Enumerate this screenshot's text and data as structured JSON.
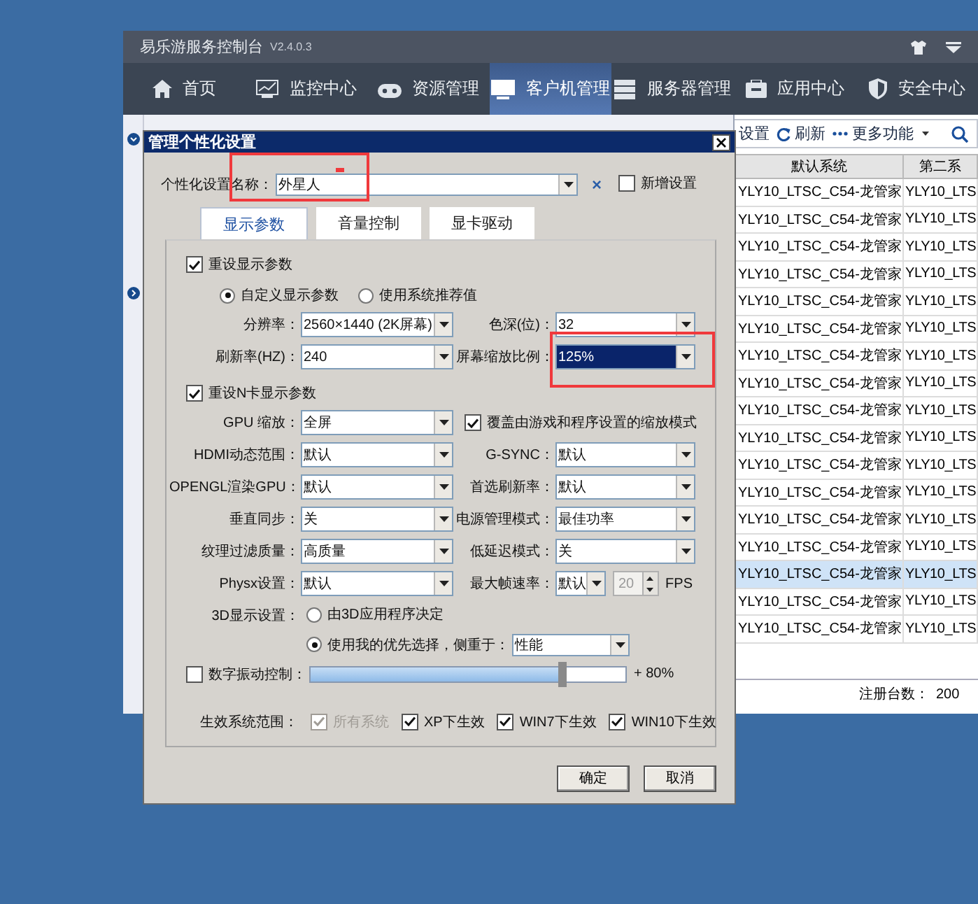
{
  "app": {
    "title": "易乐游服务控制台",
    "version": "V2.4.0.3"
  },
  "nav": [
    {
      "label": "首页",
      "selected": false
    },
    {
      "label": "监控中心",
      "selected": false
    },
    {
      "label": "资源管理",
      "selected": false
    },
    {
      "label": "客户机管理",
      "selected": true
    },
    {
      "label": "服务器管理",
      "selected": false
    },
    {
      "label": "应用中心",
      "selected": false
    },
    {
      "label": "安全中心",
      "selected": false
    }
  ],
  "toolbar": [
    {
      "label": "设置"
    },
    {
      "label": "刷新"
    },
    {
      "label": "更多功能"
    }
  ],
  "table": {
    "columns": [
      "默认系统",
      "第二系"
    ],
    "rows": [
      {
        "cells": [
          "YLY10_LTSC_C54-龙管家",
          "YLY10_LTS"
        ],
        "selected": false
      },
      {
        "cells": [
          "YLY10_LTSC_C54-龙管家",
          "YLY10_LTS"
        ],
        "selected": false
      },
      {
        "cells": [
          "YLY10_LTSC_C54-龙管家",
          "YLY10_LTS"
        ],
        "selected": false
      },
      {
        "cells": [
          "YLY10_LTSC_C54-龙管家",
          "YLY10_LTS"
        ],
        "selected": false
      },
      {
        "cells": [
          "YLY10_LTSC_C54-龙管家",
          "YLY10_LTS"
        ],
        "selected": false
      },
      {
        "cells": [
          "YLY10_LTSC_C54-龙管家",
          "YLY10_LTS"
        ],
        "selected": false
      },
      {
        "cells": [
          "YLY10_LTSC_C54-龙管家",
          "YLY10_LTS"
        ],
        "selected": false
      },
      {
        "cells": [
          "YLY10_LTSC_C54-龙管家",
          "YLY10_LTS"
        ],
        "selected": false
      },
      {
        "cells": [
          "YLY10_LTSC_C54-龙管家",
          "YLY10_LTS"
        ],
        "selected": false
      },
      {
        "cells": [
          "YLY10_LTSC_C54-龙管家",
          "YLY10_LTS"
        ],
        "selected": false
      },
      {
        "cells": [
          "YLY10_LTSC_C54-龙管家",
          "YLY10_LTS"
        ],
        "selected": false
      },
      {
        "cells": [
          "YLY10_LTSC_C54-龙管家",
          "YLY10_LTS"
        ],
        "selected": false
      },
      {
        "cells": [
          "YLY10_LTSC_C54-龙管家",
          "YLY10_LTS"
        ],
        "selected": false
      },
      {
        "cells": [
          "YLY10_LTSC_C54-龙管家",
          "YLY10_LTS"
        ],
        "selected": false
      },
      {
        "cells": [
          "YLY10_LTSC_C54-龙管家",
          "YLY10_LTS"
        ],
        "selected": true
      },
      {
        "cells": [
          "YLY10_LTSC_C54-龙管家",
          "YLY10_LTS"
        ],
        "selected": false
      },
      {
        "cells": [
          "YLY10_LTSC_C54-龙管家",
          "YLY10_LTS"
        ],
        "selected": false
      }
    ]
  },
  "status_bar": {
    "label": "注册台数：",
    "value": "200"
  },
  "dialog": {
    "title": "管理个性化设置",
    "name_field": {
      "label": "个性化设置名称：",
      "value": "外星人",
      "highlighted": true
    },
    "clear": "×",
    "new_setting": {
      "label": "新增设置",
      "checked": false
    },
    "tabs": [
      {
        "label": "显示参数",
        "selected": true
      },
      {
        "label": "音量控制",
        "selected": false
      },
      {
        "label": "显卡驱动",
        "selected": false
      }
    ],
    "display": {
      "reset": {
        "label": "重设显示参数",
        "checked": true
      },
      "modes": [
        {
          "label": "自定义显示参数",
          "selected": true
        },
        {
          "label": "使用系统推荐值",
          "selected": false
        }
      ],
      "rows": [
        [
          {
            "label": "分辨率：",
            "value": "2560×1440 (2K屏幕)",
            "highlighted": false
          },
          {
            "label": "色深(位)：",
            "value": "32",
            "highlighted": false
          }
        ],
        [
          {
            "label": "刷新率(HZ)：",
            "value": "240",
            "highlighted": false
          },
          {
            "label": "屏幕缩放比例：",
            "value": "125%",
            "highlighted": true
          }
        ]
      ]
    },
    "nvidia": {
      "reset": {
        "label": "重设N卡显示参数",
        "checked": true
      },
      "rows": [
        {
          "left": {
            "label": "GPU 缩放：",
            "value": "全屏"
          },
          "right": {
            "kind": "checkbox",
            "label": "覆盖由游戏和程序设置的缩放模式",
            "checked": true
          }
        },
        {
          "left": {
            "label": "HDMI动态范围：",
            "value": "默认"
          },
          "right": {
            "kind": "select",
            "label": "G-SYNC：",
            "value": "默认"
          }
        },
        {
          "left": {
            "label": "OPENGL渲染GPU：",
            "value": "默认"
          },
          "right": {
            "kind": "select",
            "label": "首选刷新率：",
            "value": "默认"
          }
        },
        {
          "left": {
            "label": "垂直同步：",
            "value": "关"
          },
          "right": {
            "kind": "select",
            "label": "电源管理模式：",
            "value": "最佳功率"
          }
        },
        {
          "left": {
            "label": "纹理过滤质量：",
            "value": "高质量"
          },
          "right": {
            "kind": "select",
            "label": "低延迟模式：",
            "value": "关"
          }
        },
        {
          "left": {
            "label": "Physx设置：",
            "value": "默认"
          },
          "right": {
            "kind": "fps",
            "label": "最大帧速率：",
            "value": "默认",
            "fps": "20",
            "fps_disabled": true,
            "unit": "FPS"
          }
        }
      ],
      "three_d": {
        "label": "3D显示设置：",
        "options": [
          {
            "label": "由3D应用程序决定",
            "selected": false
          },
          {
            "label": "使用我的优先选择，侧重于：",
            "selected": true
          }
        ],
        "preference": "性能"
      },
      "vibrance": {
        "label": "数字振动控制：",
        "checked": false,
        "level": 0.8,
        "reading": "+ 80%"
      }
    },
    "scope": {
      "label": "生效系统范围：",
      "options": [
        {
          "label": "所有系统",
          "checked": true,
          "disabled": true
        },
        {
          "label": "XP下生效",
          "checked": true,
          "disabled": false
        },
        {
          "label": "WIN7下生效",
          "checked": true,
          "disabled": false
        },
        {
          "label": "WIN10下生效",
          "checked": true,
          "disabled": false
        }
      ]
    },
    "buttons": [
      {
        "label": "确定"
      },
      {
        "label": "取消"
      }
    ]
  }
}
